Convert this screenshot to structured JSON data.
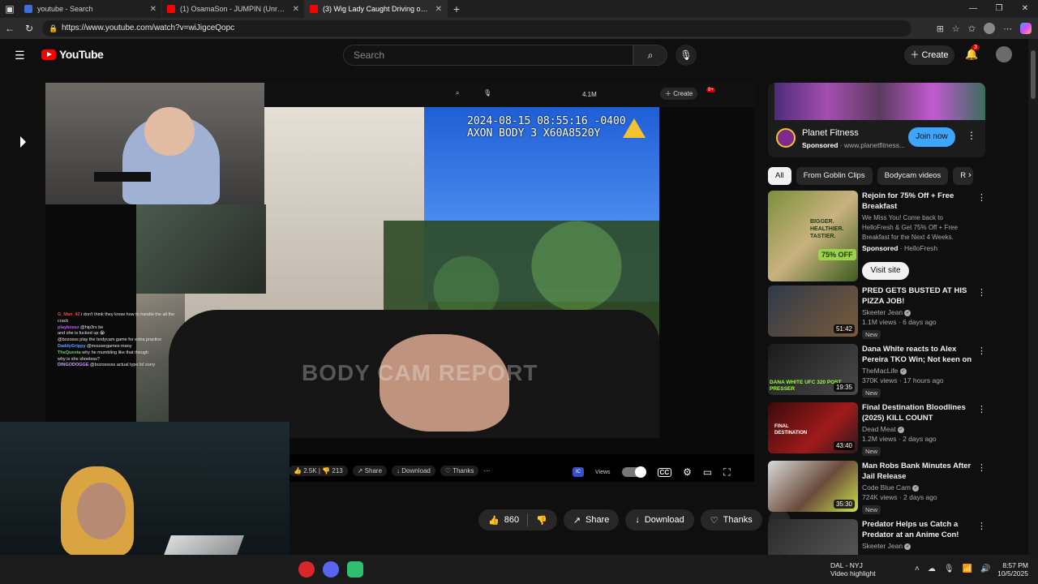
{
  "browser": {
    "tabs": [
      {
        "title": "youtube - Search",
        "color": "#3d6fd8",
        "active": false
      },
      {
        "title": "(1) OsamaSon - JUMPIN (Unrelea",
        "color": "#ff0000",
        "active": false
      },
      {
        "title": "(3) Wig Lady Caught Driving on C",
        "color": "#ff0000",
        "active": true
      }
    ],
    "url": "https://www.youtube.com/watch?v=wiJigceQopc"
  },
  "header": {
    "logo_text": "YouTube",
    "search_placeholder": "Search",
    "create_label": "Create",
    "notif_count": "3"
  },
  "video": {
    "timestamp_line1": "2024-08-15  08:55:16  -0400",
    "timestamp_line2": "AXON BODY 3  X60A8520Y",
    "watermark": "BODY CAM REPORT",
    "nested_views": "4.1M",
    "nested_create": "Create",
    "nested_notif": "9+",
    "chat": [
      {
        "name": "G_Man_42",
        "msg": "i don't think they know how to handle the all the crack"
      },
      {
        "name": "playboxsz",
        "msg": "@hip3rs be"
      },
      {
        "name": "",
        "msg": "and she is fucked up 😭"
      },
      {
        "name": "",
        "msg": "@bozosss play the bodycam game for extra practice"
      },
      {
        "name": "DaddyGrippy",
        "msg": "@mousergames many"
      },
      {
        "name": "TheQuenta",
        "msg": "why he mumbling like that though"
      },
      {
        "name": "",
        "msg": "why is she shoeless?"
      },
      {
        "name": "DINGODOGGE",
        "msg": "@bozosssss actual typo lol sorry"
      }
    ],
    "nested_like": "2.5K",
    "nested_dislike": "213",
    "nested_share": "Share",
    "nested_download": "Download",
    "nested_thanks": "Thanks",
    "views_label": "Views"
  },
  "actions": {
    "likes": "860",
    "share": "Share",
    "download": "Download",
    "thanks": "Thanks"
  },
  "ad": {
    "title": "Planet Fitness",
    "sponsored": "Sponsored",
    "domain": "· www.planetfitness...",
    "cta": "Join now"
  },
  "chips": [
    "All",
    "From Goblin Clips",
    "Bodycam videos",
    "R"
  ],
  "recs": [
    {
      "title": "Rejoin for 75% Off + Free Breakfast",
      "desc": "We Miss You! Come back to HelloFresh & Get 75% Off + Free Breakfast for the Next 4 Weeks.",
      "sponsored": "Sponsored",
      "advertiser": "· HelloFresh",
      "cta": "Visit site",
      "thumb_text": "BIGGER. HEALTHIER. TASTIER.",
      "thumb_badge": "75% OFF"
    },
    {
      "title": "PRED GETS BUSTED AT HIS PIZZA JOB!",
      "channel": "Skeeter Jean",
      "stats": "1.1M views · 6 days ago",
      "duration": "51:42",
      "badge": "New"
    },
    {
      "title": "Dana White reacts to Alex Pereira TKO Win; Not keen on ...",
      "channel": "TheMacLife",
      "stats": "370K views · 17 hours ago",
      "duration": "19:35",
      "badge": "New",
      "thumb_text": "DANA WHITE  UFC 320 POST PRESSER"
    },
    {
      "title": "Final Destination Bloodlines (2025) KILL COUNT",
      "channel": "Dead Meat",
      "stats": "1.2M views · 2 days ago",
      "duration": "43:40",
      "badge": "New",
      "thumb_text": "FINAL DESTINATION"
    },
    {
      "title": "Man Robs Bank Minutes After Jail Release",
      "channel": "Code Blue Cam",
      "stats": "724K views · 2 days ago",
      "duration": "35:30",
      "badge": "New"
    },
    {
      "title": "Predator Helps us Catch a Predator at an Anime Con!",
      "channel": "Skeeter Jean",
      "stats": "",
      "duration": "",
      "badge": ""
    }
  ],
  "taskbar": {
    "weather_line1": "DAL - NYJ",
    "weather_line2": "Video highlight",
    "time": "8:57 PM",
    "date": "10/5/2025"
  }
}
